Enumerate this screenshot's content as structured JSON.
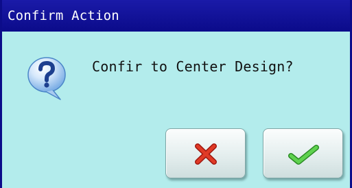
{
  "dialog": {
    "title": "Confirm Action",
    "message": "Confir to Center Design?"
  },
  "icons": {
    "question": "question-bubble-icon",
    "cancel": "red-x-icon",
    "confirm": "green-check-icon"
  },
  "colors": {
    "title_bar": "#0b0b8a",
    "dialog_background": "#b3ecec",
    "cancel_icon": "#d62d1c",
    "confirm_icon": "#3cb832",
    "question_icon": "#2a6fc4"
  }
}
